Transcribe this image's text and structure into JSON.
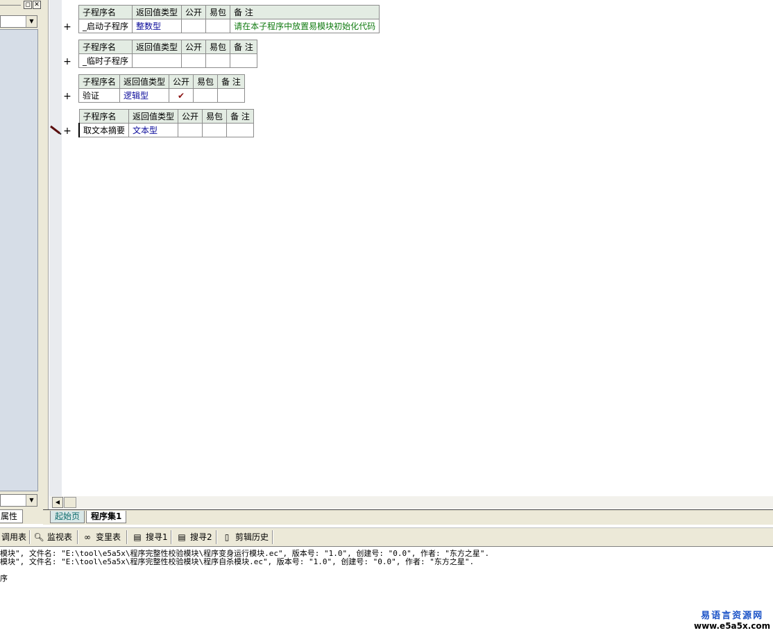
{
  "left_panel": {
    "tab_label": "属性"
  },
  "procedures": [
    {
      "headers": [
        "子程序名",
        "返回值类型",
        "公开",
        "易包",
        "备 注"
      ],
      "name": "_启动子程序",
      "return_type": "整数型",
      "public": "",
      "easy_pack": "",
      "remark": "请在本子程序中放置易模块初始化代码"
    },
    {
      "headers": [
        "子程序名",
        "返回值类型",
        "公开",
        "易包",
        "备 注"
      ],
      "name": "_临时子程序",
      "return_type": "",
      "public": "",
      "easy_pack": "",
      "remark": ""
    },
    {
      "headers": [
        "子程序名",
        "返回值类型",
        "公开",
        "易包",
        "备 注"
      ],
      "name": "验证",
      "return_type": "逻辑型",
      "public": "✔",
      "easy_pack": "",
      "remark": ""
    },
    {
      "headers": [
        "子程序名",
        "返回值类型",
        "公开",
        "易包",
        "备 注"
      ],
      "name": "取文本摘要",
      "return_type": "文本型",
      "public": "",
      "easy_pack": "",
      "remark": ""
    }
  ],
  "row_marker": "+",
  "doc_tabs": [
    "起始页",
    "程序集1"
  ],
  "toolbar": [
    {
      "label": "调用表",
      "icon": "call-table-icon"
    },
    {
      "label": "监视表",
      "icon": "magnifier-icon"
    },
    {
      "label": "变里表",
      "icon": "binoculars-icon"
    },
    {
      "label": "搜寻1",
      "icon": "search-doc-icon"
    },
    {
      "label": "搜寻2",
      "icon": "search-doc-icon"
    },
    {
      "label": "剪辑历史",
      "icon": "clipboard-icon"
    }
  ],
  "output": {
    "lines": [
      "模块\", 文件名: \"E:\\tool\\e5a5x\\程序完整性校验模块\\程序变身运行模块.ec\", 版本号: \"1.0\", 创建号: \"0.0\", 作者: \"东方之星\".",
      "模块\", 文件名: \"E:\\tool\\e5a5x\\程序完整性校验模块\\程序自杀模块.ec\", 版本号: \"1.0\", 创建号: \"0.0\", 作者: \"东方之星\".",
      "",
      "序"
    ]
  },
  "watermark": {
    "title": "易语言资源网",
    "url": "www.e5a5x.com"
  }
}
